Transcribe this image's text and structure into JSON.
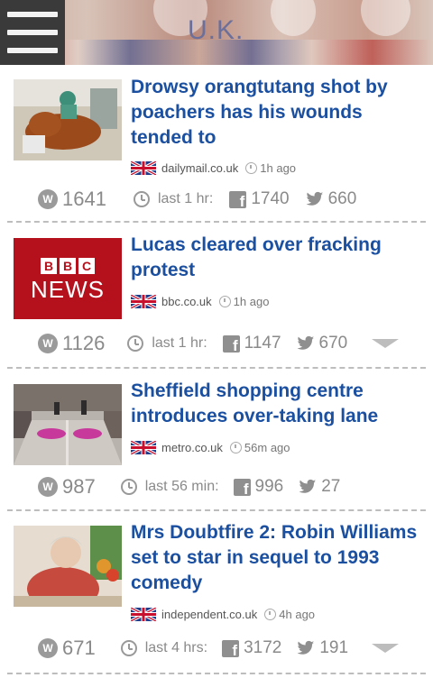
{
  "header": {
    "title": "U.K.",
    "menu_icon": "hamburger-menu-icon"
  },
  "articles": [
    {
      "title": "Drowsy orangtutang shot by poachers has his wounds tended to",
      "source": "dailymail.co.uk",
      "time": "1h ago",
      "score": "1641",
      "period": "last 1 hr:",
      "facebook": "1740",
      "twitter": "660",
      "has_chevron": false
    },
    {
      "title": "Lucas cleared over fracking protest",
      "source": "bbc.co.uk",
      "time": "1h ago",
      "score": "1126",
      "period": "last 1 hr:",
      "facebook": "1147",
      "twitter": "670",
      "thumb_text": [
        "BBC",
        "NEWS"
      ],
      "has_chevron": true
    },
    {
      "title": "Sheffield shopping centre introduces over-taking lane",
      "source": "metro.co.uk",
      "time": "56m ago",
      "score": "987",
      "period": "last 56 min:",
      "facebook": "996",
      "twitter": "27",
      "has_chevron": false
    },
    {
      "title": "Mrs Doubtfire 2: Robin Williams set to star in sequel to 1993 comedy",
      "source": "independent.co.uk",
      "time": "4h ago",
      "score": "671",
      "period": "last 4 hrs:",
      "facebook": "3172",
      "twitter": "191",
      "has_chevron": true
    }
  ],
  "colors": {
    "title": "#1b4fa0",
    "menu_bg": "#3a3a3a",
    "muted": "#8a8a8a",
    "bbc_red": "#b5111c"
  }
}
